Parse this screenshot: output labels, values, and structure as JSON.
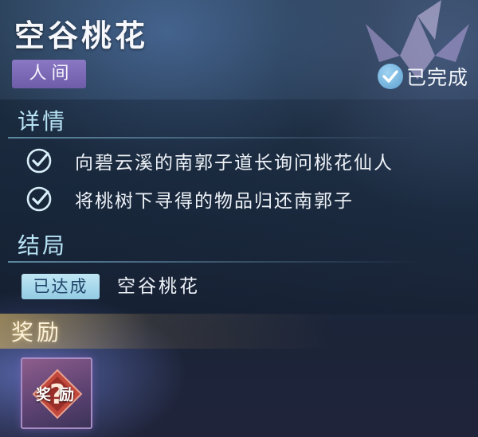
{
  "quest": {
    "title": "空谷桃花",
    "realm_tag": "人间",
    "status": {
      "label": "已完成",
      "icon": "check-circle-icon"
    }
  },
  "details": {
    "heading": "详情",
    "tasks": [
      {
        "text": "向碧云溪的南郭子道长询问桃花仙人",
        "icon": "check-icon",
        "completed": true
      },
      {
        "text": "将桃树下寻得的物品归还南郭子",
        "icon": "check-icon",
        "completed": true
      }
    ]
  },
  "ending": {
    "heading": "结局",
    "badge": "已达成",
    "name": "空谷桃花"
  },
  "rewards": {
    "heading": "奖励",
    "items": [
      {
        "label": "奖励",
        "icon": "mystery-reward-icon"
      }
    ]
  },
  "colors": {
    "accent_cyan": "#b8e4f6",
    "realm_purple": "#7a68b6",
    "badge_blue": "#a9d9ec",
    "reward_gold": "#e6be5a"
  }
}
